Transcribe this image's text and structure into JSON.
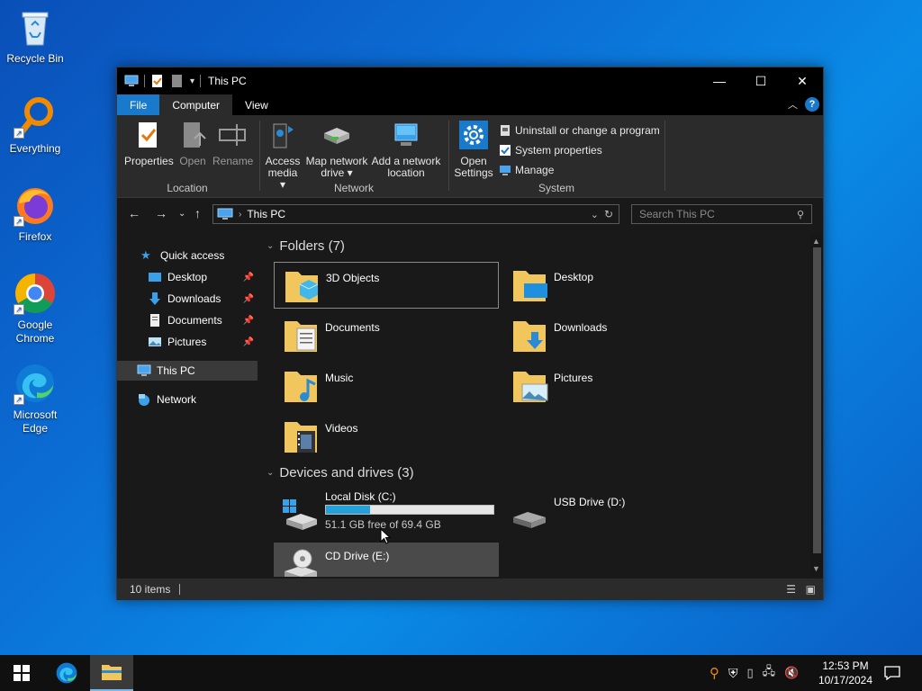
{
  "desktop": {
    "icons": [
      {
        "label": "Recycle Bin",
        "icon": "recycle-bin-icon"
      },
      {
        "label": "Everything",
        "icon": "everything-search-icon"
      },
      {
        "label": "Firefox",
        "icon": "firefox-icon"
      },
      {
        "label": "Google Chrome",
        "icon": "chrome-icon"
      },
      {
        "label": "Microsoft Edge",
        "icon": "edge-icon"
      }
    ]
  },
  "window": {
    "title": "This PC",
    "tabs": {
      "file": "File",
      "computer": "Computer",
      "view": "View"
    },
    "ribbon": {
      "location": {
        "label": "Location",
        "properties": "Properties",
        "open": "Open",
        "rename": "Rename"
      },
      "network": {
        "label": "Network",
        "access_media": "Access media ▾",
        "map_network_drive": "Map network drive ▾",
        "add_network_location": "Add a network location"
      },
      "system": {
        "label": "System",
        "open_settings": "Open Settings",
        "uninstall": "Uninstall or change a program",
        "system_properties": "System properties",
        "manage": "Manage"
      }
    },
    "address": {
      "path": "This PC",
      "search_placeholder": "Search This PC"
    },
    "nav": {
      "quick_access": "Quick access",
      "desktop": "Desktop",
      "downloads": "Downloads",
      "documents": "Documents",
      "pictures": "Pictures",
      "this_pc": "This PC",
      "network": "Network"
    },
    "folders_header": "Folders (7)",
    "folders": [
      {
        "name": "3D Objects"
      },
      {
        "name": "Desktop"
      },
      {
        "name": "Documents"
      },
      {
        "name": "Downloads"
      },
      {
        "name": "Music"
      },
      {
        "name": "Pictures"
      },
      {
        "name": "Videos"
      }
    ],
    "devices_header": "Devices and drives (3)",
    "drives": {
      "c": {
        "name": "Local Disk (C:)",
        "free_text": "51.1 GB free of 69.4 GB",
        "used_fraction": 0.264
      },
      "d": {
        "name": "USB Drive (D:)"
      },
      "e": {
        "name": "CD Drive (E:)"
      }
    },
    "status": {
      "items": "10 items"
    }
  },
  "taskbar": {
    "time": "12:53 PM",
    "date": "10/17/2024"
  },
  "colors": {
    "accent": "#1979ca",
    "drive_bar": "#26a0da"
  }
}
